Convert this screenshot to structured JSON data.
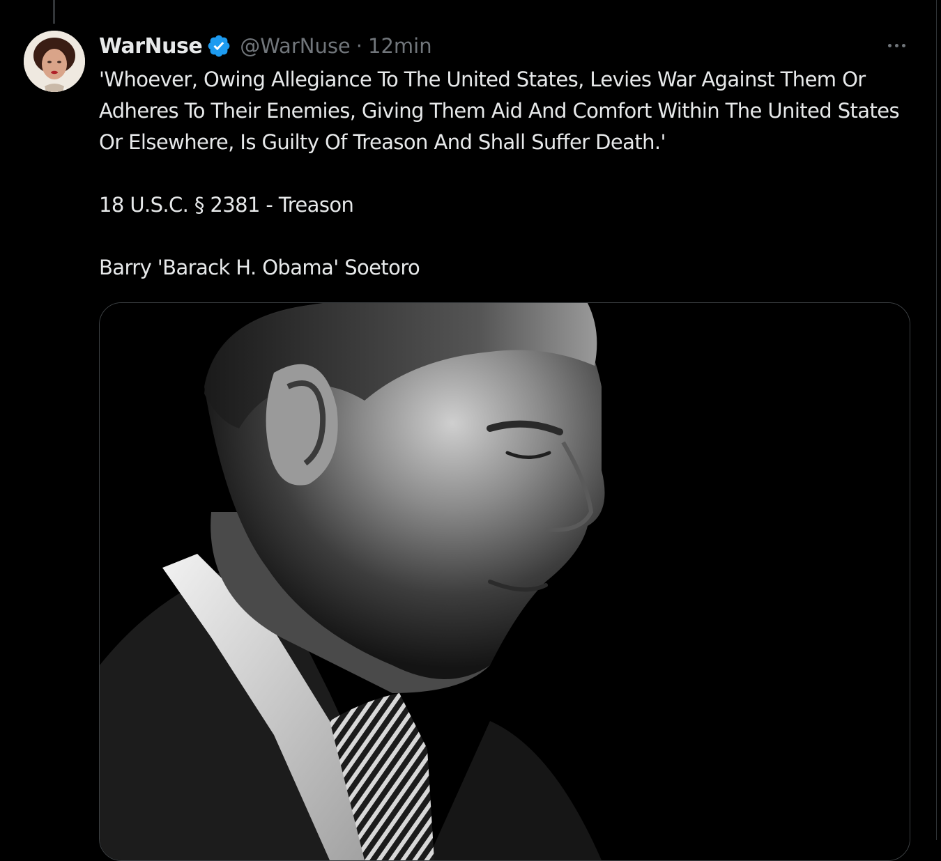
{
  "tweet": {
    "author": {
      "display_name": "WarNuse",
      "handle": "@WarNuse",
      "verified": true,
      "avatar_icon": "profile-portrait-avatar"
    },
    "separator": "·",
    "timestamp": "12min",
    "more_icon": "ellipsis-icon",
    "text_paragraphs": [
      "'Whoever, Owing Allegiance To The United States, Levies War Against Them Or Adheres To Their Enemies, Giving Them Aid And Comfort Within The United States Or Elsewhere, Is Guilty Of Treason And Shall Suffer Death.'",
      "18 U.S.C. § 2381 - Treason",
      "Barry 'Barack H. Obama' Soetoro"
    ],
    "media": {
      "type": "photo",
      "style": "black-and-white portrait, head bowed, dark background"
    }
  },
  "colors": {
    "background": "#000000",
    "text_primary": "#e7e9ea",
    "text_secondary": "#71767b",
    "verified_badge": "#1d9bf0",
    "border": "#2f3336"
  }
}
